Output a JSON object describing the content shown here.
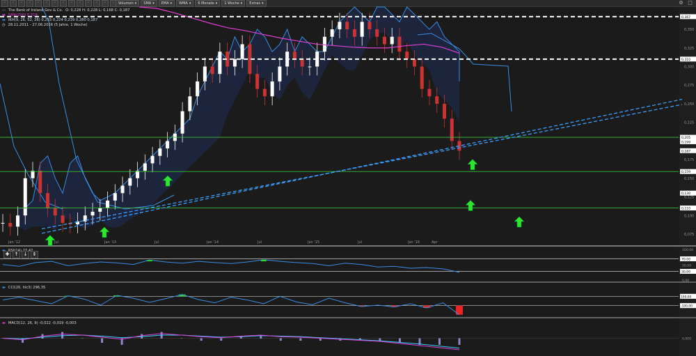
{
  "toolbar": {
    "buttons": [
      "Volumen",
      "SMA",
      "EMA",
      "WMA",
      "6 Monate",
      "1 Woche",
      "Extras"
    ],
    "icons": [
      "cursor-icon",
      "crosshair-icon",
      "zoom-in-icon",
      "zoom-out-icon",
      "pan-icon",
      "refresh-icon",
      "draw-line-icon",
      "text-icon",
      "settings-icon",
      "chart-type-icon",
      "compare-icon",
      "layout-icon",
      "save-icon",
      "print-icon",
      "share-icon",
      "export-icon",
      "fullscreen-icon",
      "undo-icon",
      "redo-icon",
      "delete-icon",
      "lock-icon",
      "eye-icon",
      "grid-icon",
      "magnet-icon",
      "ruler-icon",
      "help-icon",
      "info-icon",
      "bell-icon",
      "star-icon",
      "list-icon",
      "flag-icon",
      "tag-icon"
    ]
  },
  "colors": {
    "background": "#1b1b1b",
    "up_candle": "#ffffff",
    "down_candle": "#cc3333",
    "sma": "#e23ed6",
    "ichimoku": "#3a8ee6",
    "arrow": "#2ee62e",
    "support_green": "#3bc43b",
    "resistance_white": "#ffffff",
    "trend_blue": "#3aa0ff",
    "price_label_bg": "#ffffff",
    "osc_line": "#3a8ee6",
    "cci_pos": "#22dd22",
    "cci_neg": "#ee2222",
    "macd_line": "#e23ed6",
    "signal_line": "#3ad0ff"
  },
  "legend": {
    "title": "The Bank of Ireland Gov & Co.",
    "ohlc": "O: 0,228  H: 0,228  L: 0,168  C: 0,187",
    "sma": "SMA(200) 0,319",
    "ichimoku": "IKH(9, 26, 52, 26) 0,255  0,224  0,239  0,280  0,187",
    "range": "28.11.2011 - 27.06.2016 (5 Jahre, 1 Woche)"
  },
  "chart_data": [
    {
      "type": "line",
      "title": "The Bank of Ireland Gov & Co.",
      "x_ticks": [
        "Jan '12",
        "Jul",
        "Jan '13",
        "Jul",
        "Jan '14",
        "Jul",
        "Jan '15",
        "Jul",
        "Jan '16",
        "Apr"
      ],
      "y_ticks": [
        0.075,
        0.1,
        0.125,
        0.15,
        0.175,
        0.2,
        0.225,
        0.25,
        0.275,
        0.3,
        0.325,
        0.35
      ],
      "ylim": [
        0.06,
        0.38
      ],
      "price_labels": [
        0.367,
        0.31,
        0.205,
        0.199,
        0.187,
        0.159,
        0.13,
        0.11
      ],
      "price_label_text": [
        "0,367",
        "0,310",
        "0,205",
        "0,199",
        "0,187",
        "0,159",
        "0,130",
        "0,110"
      ],
      "y_tick_text": [
        "0,075",
        "0,100",
        "0,125",
        "0,150",
        "0,175",
        "0,200",
        "0,225",
        "0,250",
        "0,275",
        "0,300",
        "0,325",
        "0,350"
      ],
      "close_series": [
        0.09,
        0.085,
        0.1,
        0.15,
        0.16,
        0.13,
        0.11,
        0.1,
        0.09,
        0.088,
        0.092,
        0.1,
        0.105,
        0.11,
        0.12,
        0.13,
        0.14,
        0.15,
        0.16,
        0.17,
        0.18,
        0.19,
        0.2,
        0.21,
        0.24,
        0.26,
        0.28,
        0.3,
        0.29,
        0.32,
        0.3,
        0.31,
        0.33,
        0.29,
        0.27,
        0.26,
        0.28,
        0.3,
        0.32,
        0.31,
        0.3,
        0.3,
        0.32,
        0.34,
        0.35,
        0.36,
        0.35,
        0.34,
        0.36,
        0.35,
        0.34,
        0.33,
        0.34,
        0.32,
        0.31,
        0.3,
        0.27,
        0.26,
        0.25,
        0.23,
        0.2,
        0.187
      ],
      "sma200_series": [
        0.38,
        0.378,
        0.372,
        0.365,
        0.358,
        0.352,
        0.348,
        0.343,
        0.338,
        0.334,
        0.33,
        0.328,
        0.326,
        0.325,
        0.325,
        0.328,
        0.33,
        0.326,
        0.318
      ],
      "support_lines": [
        0.205,
        0.159,
        0.11
      ],
      "resistance_lines": [
        0.367,
        0.31
      ],
      "arrows_count": 7
    },
    {
      "type": "line",
      "title": "RSI(14) 27,42",
      "ylim": [
        0,
        100
      ],
      "levels": [
        70,
        30
      ],
      "level_text": [
        "70,00",
        "30,00"
      ],
      "y_tick_text": [
        "100,00",
        "50,00",
        "0,00"
      ],
      "values": [
        52,
        46,
        58,
        62,
        48,
        55,
        60,
        57,
        52,
        66,
        60,
        56,
        62,
        58,
        55,
        60,
        67,
        62,
        58,
        55,
        48,
        56,
        52,
        44,
        46,
        40,
        42,
        38,
        27
      ]
    },
    {
      "type": "area",
      "title": "CCI(20, hlc3) 296,35",
      "levels": [
        100,
        -100
      ],
      "level_text": [
        "100,00",
        "-100,00"
      ],
      "values": [
        20,
        80,
        10,
        -60,
        110,
        40,
        -90,
        120,
        60,
        -30,
        50,
        140,
        30,
        -40,
        80,
        20,
        -60,
        100,
        -20,
        -80,
        60,
        -40,
        -120,
        -90,
        -130,
        -60,
        -150,
        -40,
        -296
      ]
    },
    {
      "type": "line",
      "title": "MACD(12, 26, 9) -0,022  -0,019  -0,003",
      "y_tick_text": [
        "0,000"
      ],
      "macd": [
        0,
        -0.003,
        0.004,
        0.008,
        0.006,
        0.002,
        -0.002,
        0.005,
        0.009,
        0.006,
        0.003,
        0.001,
        0.004,
        0.006,
        0.003,
        0.002,
        0.0,
        -0.002,
        -0.004,
        -0.006,
        -0.01,
        -0.014,
        -0.018,
        -0.022
      ],
      "signal": [
        0,
        -0.001,
        0.002,
        0.005,
        0.006,
        0.004,
        0.001,
        0.003,
        0.006,
        0.006,
        0.004,
        0.002,
        0.003,
        0.005,
        0.004,
        0.003,
        0.001,
        -0.001,
        -0.003,
        -0.005,
        -0.008,
        -0.011,
        -0.015,
        -0.019
      ]
    }
  ]
}
